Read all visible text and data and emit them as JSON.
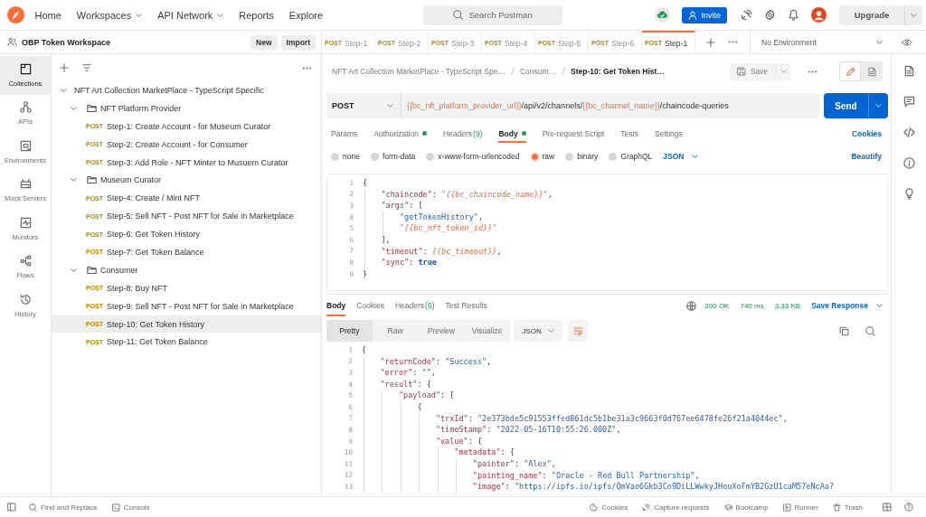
{
  "top_bar": {
    "nav": [
      {
        "label": "Home",
        "dropdown": false
      },
      {
        "label": "Workspaces",
        "dropdown": true
      },
      {
        "label": "API Network",
        "dropdown": true
      },
      {
        "label": "Reports",
        "dropdown": false
      },
      {
        "label": "Explore",
        "dropdown": false
      }
    ],
    "search": {
      "placeholder": "Search Postman"
    },
    "invite_button": "Invite",
    "upgrade_button": "Upgrade"
  },
  "workspace": {
    "name": "OBP Token Workspace",
    "buttons": [
      "New",
      "Import"
    ]
  },
  "open_tabs": [
    {
      "method": "POST",
      "label": "Step-1",
      "selected": false
    },
    {
      "method": "POST",
      "label": "Step-2",
      "selected": false
    },
    {
      "method": "POST",
      "label": "Step-3",
      "selected": false
    },
    {
      "method": "POST",
      "label": "Step-4",
      "selected": false
    },
    {
      "method": "POST",
      "label": "Step-5",
      "selected": false
    },
    {
      "method": "POST",
      "label": "Step-6",
      "selected": false
    },
    {
      "method": "POST",
      "label": "Step-1",
      "selected": true
    }
  ],
  "environment": {
    "value": "No Environment"
  },
  "sidebar": {
    "items": [
      {
        "label": "Collections",
        "selected": true
      },
      {
        "label": "APIs",
        "selected": false
      },
      {
        "label": "Environments",
        "selected": false
      },
      {
        "label": "Mock Servers",
        "selected": false
      },
      {
        "label": "Monitors",
        "selected": false
      },
      {
        "label": "Flows",
        "selected": false
      },
      {
        "label": "History",
        "selected": false
      }
    ]
  },
  "collections": [
    {
      "kind": "collection",
      "name": "NFT Art Collection MarketPlace - TypeScript Specific",
      "expanded": true,
      "children": [
        {
          "kind": "folder",
          "name": "NFT Platform Provider",
          "expanded": true,
          "children": [
            {
              "kind": "request",
              "method": "POST",
              "name": "Step-1: Create Account - for Museum Curator",
              "selected": false
            },
            {
              "kind": "request",
              "method": "POST",
              "name": "Step-2: Create Account - for Consumer",
              "selected": false
            },
            {
              "kind": "request",
              "method": "POST",
              "name": "Step-3: Add Role - NFT Minter to Musuem Curator",
              "selected": false
            }
          ]
        },
        {
          "kind": "folder",
          "name": "Museum Curator",
          "expanded": true,
          "children": [
            {
              "kind": "request",
              "method": "POST",
              "name": "Step-4: Create / Mint NFT",
              "selected": false
            },
            {
              "kind": "request",
              "method": "POST",
              "name": "Step-5: Sell NFT - Post NFT for Sale in Marketplace",
              "selected": false
            },
            {
              "kind": "request",
              "method": "POST",
              "name": "Step-6: Get Token History",
              "selected": false
            },
            {
              "kind": "request",
              "method": "POST",
              "name": "Step-7: Get Token Balance",
              "selected": false
            }
          ]
        },
        {
          "kind": "folder",
          "name": "Consumer",
          "expanded": true,
          "children": [
            {
              "kind": "request",
              "method": "POST",
              "name": "Step-8: Buy NFT",
              "selected": false
            },
            {
              "kind": "request",
              "method": "POST",
              "name": "Step-9: Sell NFT - Post NFT for Sale in Marketplace",
              "selected": false
            },
            {
              "kind": "request",
              "method": "POST",
              "name": "Step-10: Get Token History",
              "selected": true
            },
            {
              "kind": "request",
              "method": "POST",
              "name": "Step-11: Get Token Balance",
              "selected": false
            }
          ]
        }
      ]
    }
  ],
  "breadcrumb": [
    "NFT Art Collection MarketPlace - TypeScript Spe…",
    "Consum…",
    "Step-10: Get Token Hist…"
  ],
  "save_button": {
    "label": "Save",
    "disabled": true
  },
  "editor_modes": [
    {
      "selected": true
    },
    {
      "selected": false
    }
  ],
  "request": {
    "method": "POST",
    "url": [
      {
        "kind": "variable",
        "text": "{{bc_nft_platform_provider_url}}"
      },
      {
        "kind": "text",
        "text": "/api/v2/channels/"
      },
      {
        "kind": "variable",
        "text": "{{bc_channel_name}}"
      },
      {
        "kind": "text",
        "text": "/chaincode-queries"
      }
    ],
    "send_button": "Send"
  },
  "request_sections": {
    "tabs": [
      {
        "label": "Params",
        "selected": false,
        "dot": false
      },
      {
        "label": "Authorization",
        "selected": false,
        "dot": true
      },
      {
        "label": "Headers",
        "count": "(9)",
        "selected": false,
        "dot": false
      },
      {
        "label": "Body",
        "selected": true,
        "dot": true
      },
      {
        "label": "Pre-request Script",
        "selected": false,
        "dot": false
      },
      {
        "label": "Tests",
        "selected": false,
        "dot": false
      },
      {
        "label": "Settings",
        "selected": false,
        "dot": false
      }
    ],
    "link": "Cookies"
  },
  "body_modes": {
    "options": [
      {
        "label": "none",
        "selected": false
      },
      {
        "label": "form-data",
        "selected": false
      },
      {
        "label": "x-www-form-urlencoded",
        "selected": false
      },
      {
        "label": "raw",
        "selected": true
      },
      {
        "label": "binary",
        "selected": false
      },
      {
        "label": "GraphQL",
        "selected": false
      }
    ],
    "language": "JSON",
    "link": "Beautify"
  },
  "request_body": {
    "lines": [
      {
        "number": "1",
        "tokens": [
          {
            "kind": "punct",
            "text": "{"
          }
        ]
      },
      {
        "number": "2",
        "tokens": [
          {
            "kind": "key",
            "text": "    \"chaincode\""
          },
          {
            "kind": "punct",
            "text": ": "
          },
          {
            "kind": "variable",
            "text": "\"{{bc_chaincode_name}}\""
          },
          {
            "kind": "punct",
            "text": ","
          }
        ]
      },
      {
        "number": "3",
        "tokens": [
          {
            "kind": "key",
            "text": "    \"args\""
          },
          {
            "kind": "punct",
            "text": ": ["
          }
        ]
      },
      {
        "number": "4",
        "tokens": [
          {
            "kind": "string",
            "text": "        \"getTokenHistory\""
          },
          {
            "kind": "punct",
            "text": ","
          }
        ]
      },
      {
        "number": "5",
        "tokens": [
          {
            "kind": "variable",
            "text": "        \"{{bc_nft_token_id}}\""
          }
        ]
      },
      {
        "number": "6",
        "tokens": [
          {
            "kind": "punct",
            "text": "    ],"
          }
        ]
      },
      {
        "number": "7",
        "tokens": [
          {
            "kind": "key",
            "text": "    \"timeout\""
          },
          {
            "kind": "punct",
            "text": ": "
          },
          {
            "kind": "variable",
            "text": "{{bc_timeout}}"
          },
          {
            "kind": "punct",
            "text": ","
          }
        ]
      },
      {
        "number": "8",
        "tokens": [
          {
            "kind": "key",
            "text": "    \"sync\""
          },
          {
            "kind": "punct",
            "text": ": "
          },
          {
            "kind": "keyword",
            "text": "true"
          }
        ]
      },
      {
        "number": "9",
        "tokens": [
          {
            "kind": "punct",
            "text": "}"
          }
        ]
      }
    ]
  },
  "response": {
    "tabs": [
      {
        "label": "Body",
        "selected": true
      },
      {
        "label": "Cookies",
        "selected": false
      },
      {
        "label": "Headers",
        "count": "(6)",
        "selected": false
      },
      {
        "label": "Test Results",
        "selected": false
      }
    ],
    "status": "200 OK",
    "time": "740 ms",
    "size": "3.33 KB",
    "save_button": "Save Response",
    "views": [
      {
        "label": "Pretty",
        "selected": true
      },
      {
        "label": "Raw",
        "selected": false
      },
      {
        "label": "Preview",
        "selected": false
      },
      {
        "label": "Visualize",
        "selected": false
      }
    ],
    "format": "JSON",
    "wrap_lines": true,
    "lines": [
      {
        "number": "1",
        "tokens": [
          {
            "kind": "punct",
            "text": "{"
          }
        ]
      },
      {
        "number": "2",
        "tokens": [
          {
            "kind": "key",
            "text": "    \"returnCode\""
          },
          {
            "kind": "punct",
            "text": ": "
          },
          {
            "kind": "string",
            "text": "\"Success\""
          },
          {
            "kind": "punct",
            "text": ","
          }
        ]
      },
      {
        "number": "3",
        "tokens": [
          {
            "kind": "key",
            "text": "    \"error\""
          },
          {
            "kind": "punct",
            "text": ": "
          },
          {
            "kind": "string",
            "text": "\"\""
          },
          {
            "kind": "punct",
            "text": ","
          }
        ]
      },
      {
        "number": "4",
        "tokens": [
          {
            "kind": "key",
            "text": "    \"result\""
          },
          {
            "kind": "punct",
            "text": ": {"
          }
        ]
      },
      {
        "number": "5",
        "tokens": [
          {
            "kind": "key",
            "text": "        \"payload\""
          },
          {
            "kind": "punct",
            "text": ": ["
          }
        ]
      },
      {
        "number": "6",
        "tokens": [
          {
            "kind": "punct",
            "text": "            {"
          }
        ]
      },
      {
        "number": "7",
        "tokens": [
          {
            "kind": "key",
            "text": "                \"trxId\""
          },
          {
            "kind": "punct",
            "text": ": "
          },
          {
            "kind": "string",
            "text": "\"2e373bde5c91553ffed861dc5b1be31a3c9663f0d767ee6478fe26f21a4044ec\""
          },
          {
            "kind": "punct",
            "text": ","
          }
        ]
      },
      {
        "number": "8",
        "tokens": [
          {
            "kind": "key",
            "text": "                \"timeStamp\""
          },
          {
            "kind": "punct",
            "text": ": "
          },
          {
            "kind": "string",
            "text": "\"2022-05-16T10:55:26.000Z\""
          },
          {
            "kind": "punct",
            "text": ","
          }
        ]
      },
      {
        "number": "9",
        "tokens": [
          {
            "kind": "key",
            "text": "                \"value\""
          },
          {
            "kind": "punct",
            "text": ": {"
          }
        ]
      },
      {
        "number": "10",
        "tokens": [
          {
            "kind": "key",
            "text": "                    \"metadata\""
          },
          {
            "kind": "punct",
            "text": ": {"
          }
        ]
      },
      {
        "number": "11",
        "tokens": [
          {
            "kind": "key",
            "text": "                        \"painter\""
          },
          {
            "kind": "punct",
            "text": ": "
          },
          {
            "kind": "string",
            "text": "\"Alex\""
          },
          {
            "kind": "punct",
            "text": ","
          }
        ]
      },
      {
        "number": "12",
        "tokens": [
          {
            "kind": "key",
            "text": "                        \"painting_name\""
          },
          {
            "kind": "punct",
            "text": ": "
          },
          {
            "kind": "string",
            "text": "\"Oracle - Red Bull Partnership\""
          },
          {
            "kind": "punct",
            "text": ","
          }
        ]
      },
      {
        "number": "13",
        "tokens": [
          {
            "kind": "key",
            "text": "                        \"image\""
          },
          {
            "kind": "punct",
            "text": ": "
          },
          {
            "kind": "string",
            "text": "\"https://ipfs.io/ipfs/QmVao6Gkb3Co9DiLLWwkyJHouXoFmYB2GzU1caM57eNcAa?"
          }
        ]
      }
    ]
  },
  "status_bar": {
    "left": [
      "Find and Replace",
      "Console"
    ],
    "right": [
      "Cookies",
      "Capture requests",
      "Bootcamp",
      "Runner",
      "Trash"
    ]
  }
}
